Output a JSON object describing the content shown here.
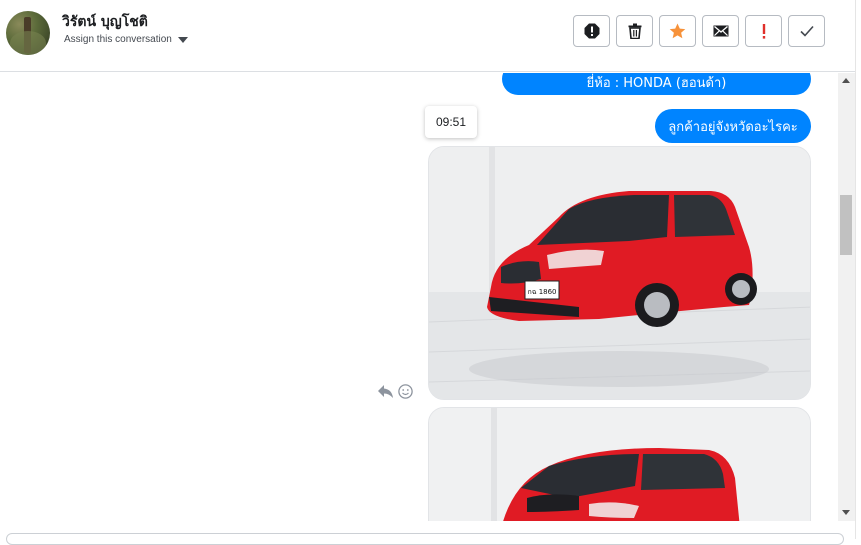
{
  "header": {
    "contact_name": "วิรัตน์ บุญโชติ",
    "assign_label": "Assign this conversation",
    "actions": [
      {
        "name": "alert-octagon-button",
        "icon": "exclamation-octagon-icon"
      },
      {
        "name": "delete-button",
        "icon": "trash-icon"
      },
      {
        "name": "star-button",
        "icon": "star-icon",
        "color": "#f7923a"
      },
      {
        "name": "mail-button",
        "icon": "envelope-icon"
      },
      {
        "name": "important-button",
        "icon": "exclamation-icon",
        "color": "#e0302b"
      },
      {
        "name": "done-button",
        "icon": "check-icon"
      }
    ]
  },
  "messages": {
    "brand_text": "ยี่ห้อ : HONDA (ฮอนด้า)",
    "province_question": "ลูกค้าอยู่จังหวัดอะไรคะ",
    "timestamp": "09:51",
    "bubble_color": "#0084ff",
    "photos": [
      {
        "subject": "red Honda Jazz hatchback",
        "plate": "กฉ 1860"
      },
      {
        "subject": "red Honda Jazz hatchback"
      }
    ],
    "reactions": [
      "reply-icon",
      "smiley-icon"
    ]
  },
  "scrollbar": {
    "position_fraction": 0.28
  }
}
